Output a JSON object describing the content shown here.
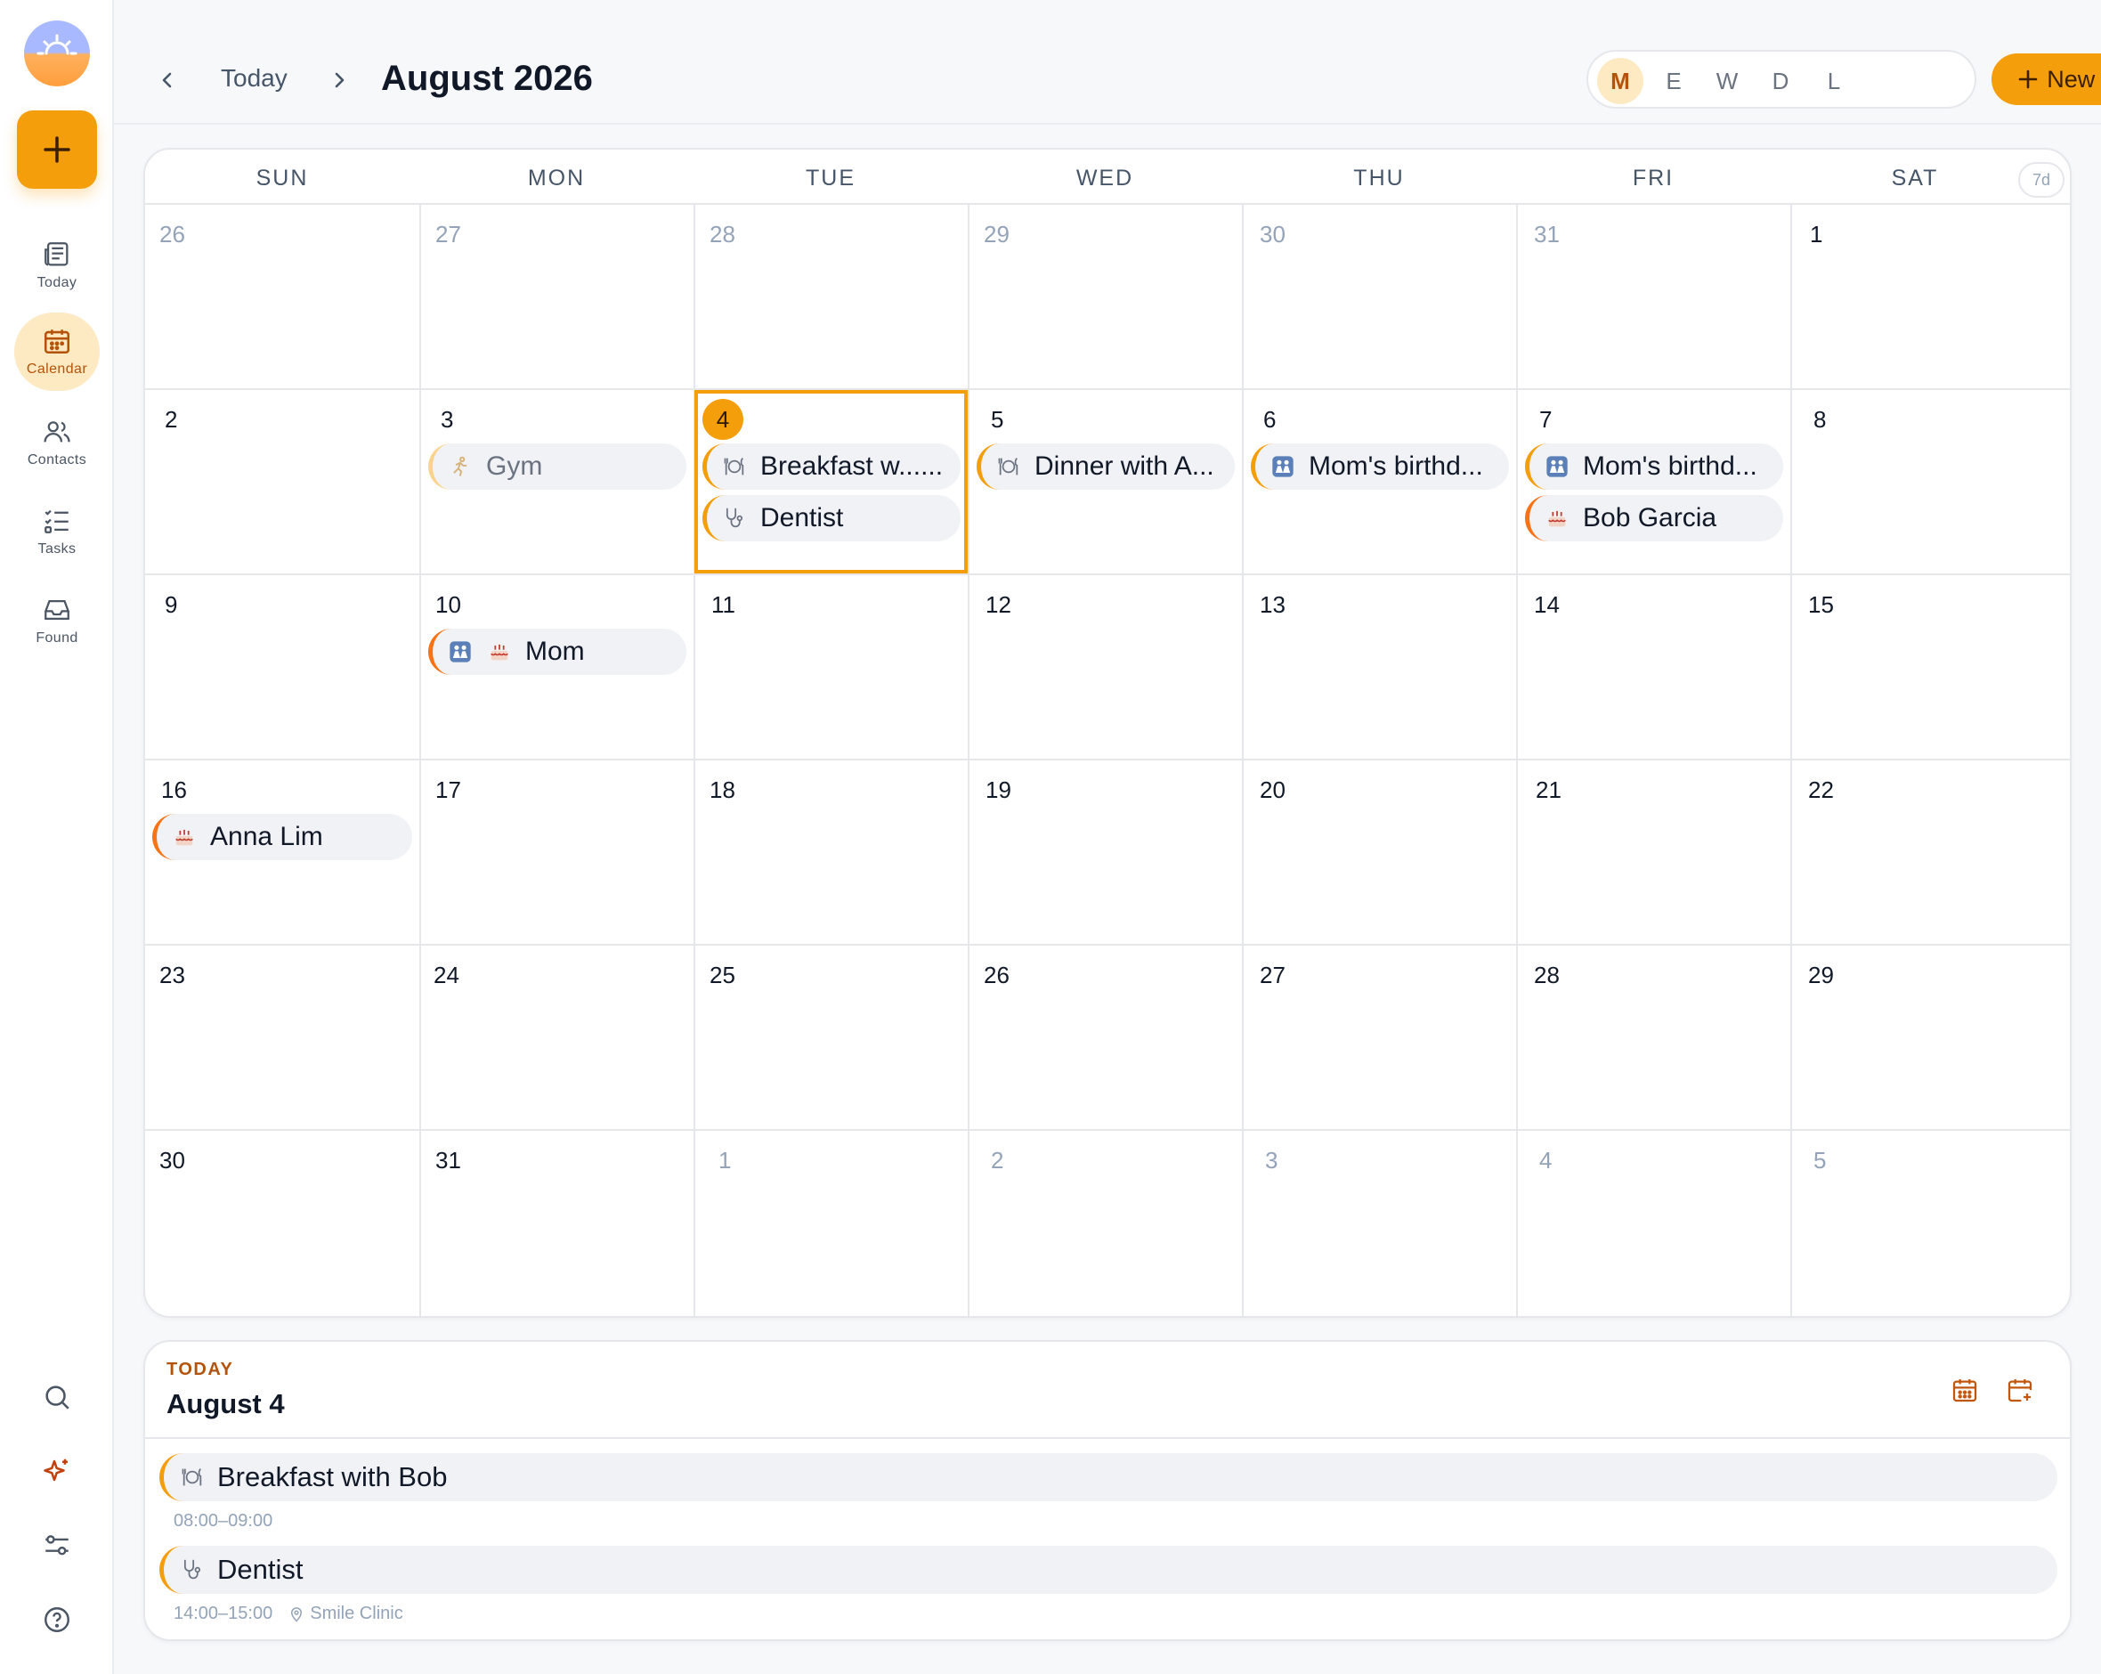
{
  "sidebar": {
    "nav": [
      {
        "label": "Today",
        "icon": "newspaper-icon"
      },
      {
        "label": "Calendar",
        "icon": "calendar-icon"
      },
      {
        "label": "Contacts",
        "icon": "contacts-icon"
      },
      {
        "label": "Tasks",
        "icon": "tasks-icon"
      },
      {
        "label": "Found",
        "icon": "inbox-icon"
      }
    ],
    "bottom_icons": [
      "search-icon",
      "sparkle-icon",
      "settings-sliders-icon",
      "help-icon"
    ]
  },
  "header": {
    "today_label": "Today",
    "title": "August 2026",
    "views": [
      "M",
      "E",
      "W",
      "D",
      "L"
    ],
    "active_view": "M",
    "new_event_label": "New event"
  },
  "calendar": {
    "weekdays": [
      "SUN",
      "MON",
      "TUE",
      "WED",
      "THU",
      "FRI",
      "SAT"
    ],
    "range_badge": "7d",
    "weeks": [
      [
        "26",
        "27",
        "28",
        "29",
        "30",
        "31",
        "1"
      ],
      [
        "2",
        "3",
        "4",
        "5",
        "6",
        "7",
        "8"
      ],
      [
        "9",
        "10",
        "11",
        "12",
        "13",
        "14",
        "15"
      ],
      [
        "16",
        "17",
        "18",
        "19",
        "20",
        "21",
        "22"
      ],
      [
        "23",
        "24",
        "25",
        "26",
        "27",
        "28",
        "29"
      ],
      [
        "30",
        "31",
        "1",
        "2",
        "3",
        "4",
        "5"
      ]
    ],
    "events": {
      "gym": "Gym",
      "breakfast": "Breakfast w......",
      "dentist": "Dentist",
      "dinner": "Dinner with A...",
      "moms_bday_thu": "Mom's birthd...",
      "moms_bday_fri": "Mom's birthd...",
      "bob_garcia": "Bob Garcia",
      "mom": "Mom",
      "anna_lim": "Anna Lim"
    }
  },
  "agenda": {
    "kicker": "TODAY",
    "title": "August 4",
    "events": [
      {
        "title": "Breakfast with Bob",
        "time": "08:00–09:00",
        "location": ""
      },
      {
        "title": "Dentist",
        "time": "14:00–15:00",
        "location": "Smile Clinic"
      }
    ]
  },
  "colors": {
    "accent": "#f59e0b",
    "accent_soft": "#fde9c2",
    "accent_text": "#b45309",
    "event_bar_orange": "#f97316"
  }
}
